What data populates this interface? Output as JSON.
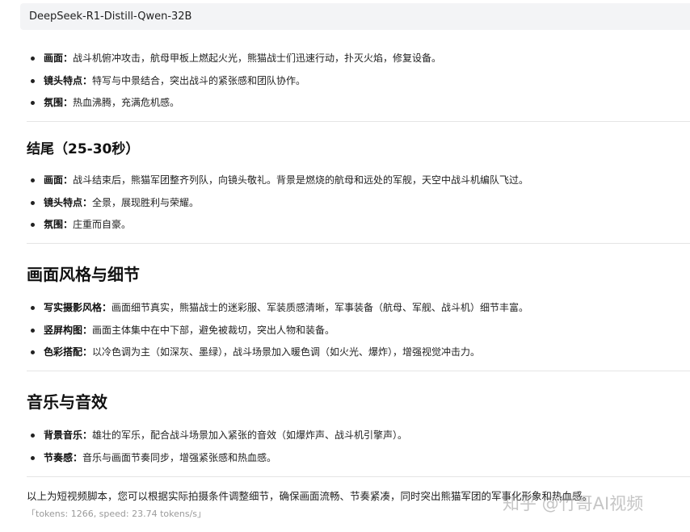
{
  "header": {
    "model_name": "DeepSeek-R1-Distill-Qwen-32B"
  },
  "section_battle": {
    "items": [
      {
        "label": "画面",
        "text": "战斗机俯冲攻击，航母甲板上燃起火光，熊猫战士们迅速行动，扑灭火焰，修复设备。"
      },
      {
        "label": "镜头特点",
        "text": "特写与中景结合，突出战斗的紧张感和团队协作。"
      },
      {
        "label": "氛围",
        "text": "热血沸腾，充满危机感。"
      }
    ]
  },
  "section_ending": {
    "title": "结尾（25-30秒）",
    "items": [
      {
        "label": "画面",
        "text": "战斗结束后，熊猫军团整齐列队，向镜头敬礼。背景是燃烧的航母和远处的军舰，天空中战斗机编队飞过。"
      },
      {
        "label": "镜头特点",
        "text": "全景，展现胜利与荣耀。"
      },
      {
        "label": "氛围",
        "text": "庄重而自豪。"
      }
    ]
  },
  "section_style": {
    "title": "画面风格与细节",
    "items": [
      {
        "label": "写实摄影风格",
        "text": "画面细节真实，熊猫战士的迷彩服、军装质感清晰，军事装备（航母、军舰、战斗机）细节丰富。"
      },
      {
        "label": "竖屏构图",
        "text": "画面主体集中在中下部，避免被裁切，突出人物和装备。"
      },
      {
        "label": "色彩搭配",
        "text": "以冷色调为主（如深灰、墨绿），战斗场景加入暖色调（如火光、爆炸），增强视觉冲击力。"
      }
    ]
  },
  "section_audio": {
    "title": "音乐与音效",
    "items": [
      {
        "label": "背景音乐",
        "text": "雄壮的军乐，配合战斗场景加入紧张的音效（如爆炸声、战斗机引擎声）。"
      },
      {
        "label": "节奏感",
        "text": "音乐与画面节奏同步，增强紧张感和热血感。"
      }
    ]
  },
  "footer": {
    "summary": "以上为短视频脚本，您可以根据实际拍摄条件调整细节，确保画面流畅、节奏紧凑，同时突出熊猫军团的军事化形象和热血感。",
    "tokens": "「tokens: 1266, speed: 23.74 tokens/s」"
  },
  "watermark": "知乎 @竹哥AI视频"
}
